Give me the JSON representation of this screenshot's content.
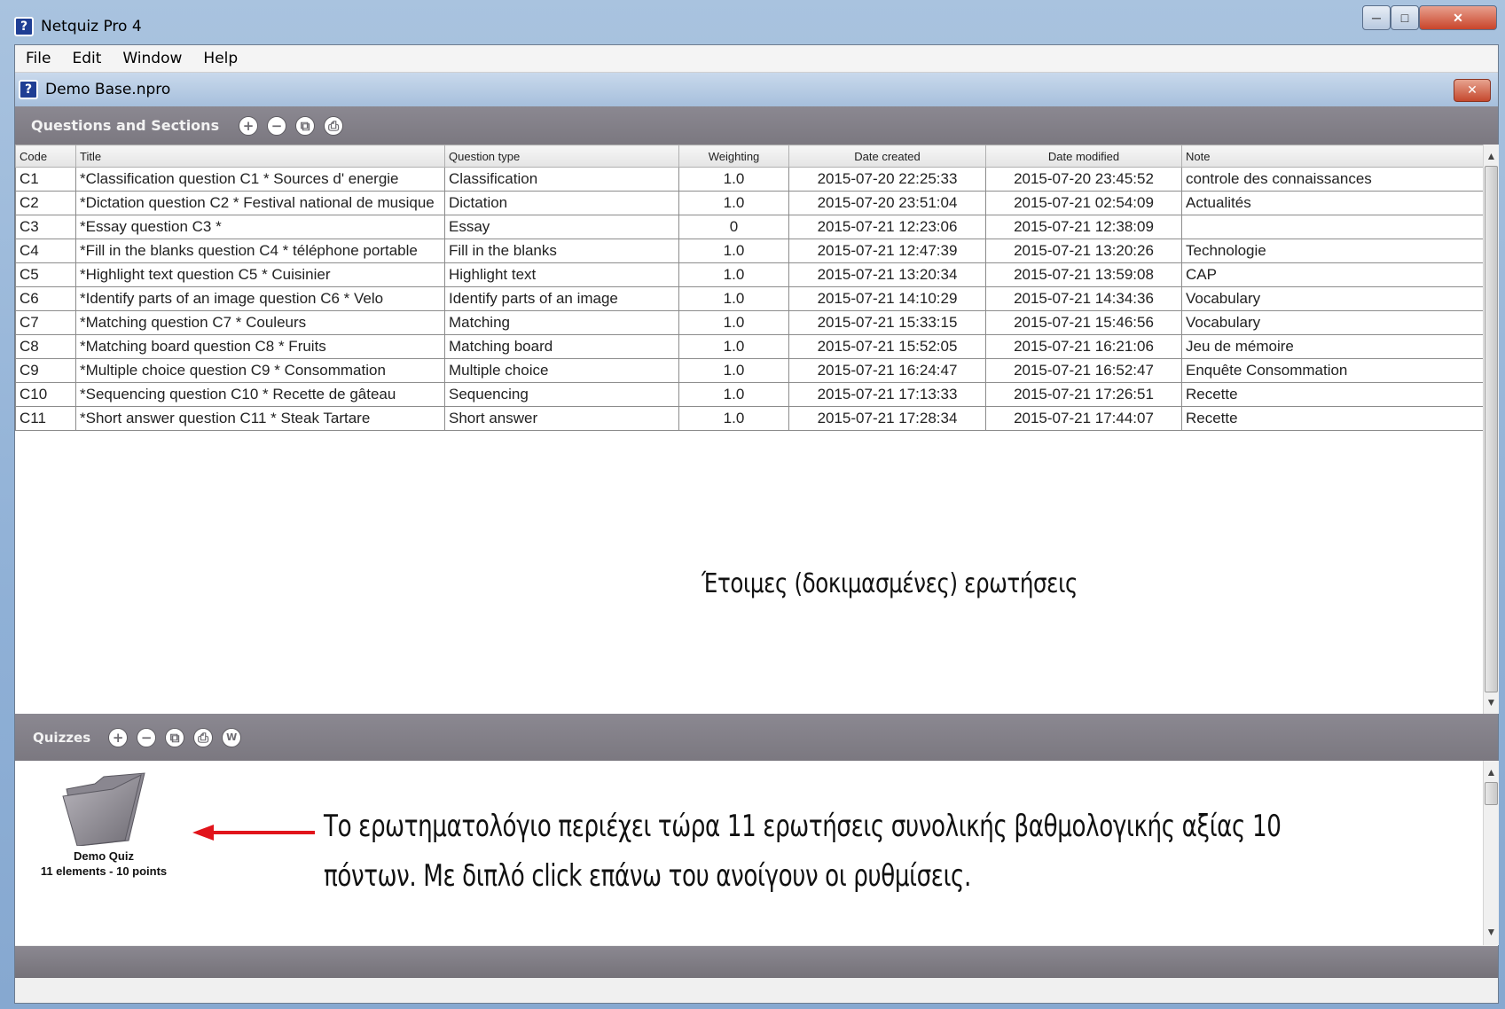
{
  "window": {
    "title": "Netquiz Pro 4",
    "minimize_glyph": "─",
    "maximize_glyph": "□",
    "close_glyph": "✕"
  },
  "menu": [
    "File",
    "Edit",
    "Window",
    "Help"
  ],
  "document": {
    "title": "Demo Base.npro",
    "close_glyph": "✕"
  },
  "questions_panel": {
    "title": "Questions and Sections",
    "toolbar_icons": [
      "add-icon",
      "remove-icon",
      "duplicate-icon",
      "print-icon"
    ],
    "toolbar_glyphs": [
      "+",
      "−",
      "⧉",
      "⎙"
    ],
    "columns": [
      "Code",
      "Title",
      "Question type",
      "Weighting",
      "Date created",
      "Date modified",
      "Note"
    ],
    "rows": [
      [
        "C1",
        "*Classification question C1 * Sources d' energie",
        "Classification",
        "1.0",
        "2015-07-20 22:25:33",
        "2015-07-20 23:45:52",
        "controle des connaissances"
      ],
      [
        "C2",
        "*Dictation question C2 * Festival national de musique",
        "Dictation",
        "1.0",
        "2015-07-20 23:51:04",
        "2015-07-21 02:54:09",
        "Actualités"
      ],
      [
        "C3",
        "*Essay question C3 *",
        "Essay",
        "0",
        "2015-07-21 12:23:06",
        "2015-07-21 12:38:09",
        ""
      ],
      [
        "C4",
        "*Fill in the blanks question C4 * téléphone portable",
        "Fill in the blanks",
        "1.0",
        "2015-07-21 12:47:39",
        "2015-07-21 13:20:26",
        "Technologie"
      ],
      [
        "C5",
        "*Highlight text question C5 * Cuisinier",
        "Highlight text",
        "1.0",
        "2015-07-21 13:20:34",
        "2015-07-21 13:59:08",
        "CAP"
      ],
      [
        "C6",
        "*Identify parts of an image  question C6 * Velo",
        "Identify parts of an image",
        "1.0",
        "2015-07-21 14:10:29",
        "2015-07-21 14:34:36",
        "Vocabulary"
      ],
      [
        "C7",
        "*Matching question C7 * Couleurs",
        "Matching",
        "1.0",
        "2015-07-21 15:33:15",
        "2015-07-21 15:46:56",
        "Vocabulary"
      ],
      [
        "C8",
        "*Matching board question C8 * Fruits",
        "Matching board",
        "1.0",
        "2015-07-21 15:52:05",
        "2015-07-21 16:21:06",
        "Jeu de mémoire"
      ],
      [
        "C9",
        "*Multiple choice question C9 * Consommation",
        "Multiple choice",
        "1.0",
        "2015-07-21 16:24:47",
        "2015-07-21 16:52:47",
        "Enquête Consommation"
      ],
      [
        "C10",
        "*Sequencing question C10 * Recette de gâteau",
        "Sequencing",
        "1.0",
        "2015-07-21 17:13:33",
        "2015-07-21 17:26:51",
        "Recette"
      ],
      [
        "C11",
        "*Short answer question C11 * Steak Tartare",
        "Short answer",
        "1.0",
        "2015-07-21 17:28:34",
        "2015-07-21 17:44:07",
        "Recette"
      ]
    ],
    "annotation": "Έτοιμες (δοκιμασμένες) ερωτήσεις"
  },
  "quizzes_panel": {
    "title": "Quizzes",
    "toolbar_icons": [
      "add-icon",
      "remove-icon",
      "duplicate-icon",
      "print-icon",
      "word-export-icon"
    ],
    "toolbar_glyphs": [
      "+",
      "−",
      "⧉",
      "⎙",
      "W"
    ],
    "quiz": {
      "name": "Demo Quiz",
      "summary": "11 elements - 10 points"
    },
    "annotation_line1": "Το ερωτηματολόγιο περιέχει τώρα 11 ερωτήσεις συνολικής βαθμολογικής αξίας 10",
    "annotation_line2": "πόντων. Με διπλό click επάνω του ανοίγουν οι ρυθμίσεις."
  },
  "colors": {
    "panel_header": "#86838b",
    "arrow": "#e1141b",
    "frame": "#9cb8da"
  }
}
